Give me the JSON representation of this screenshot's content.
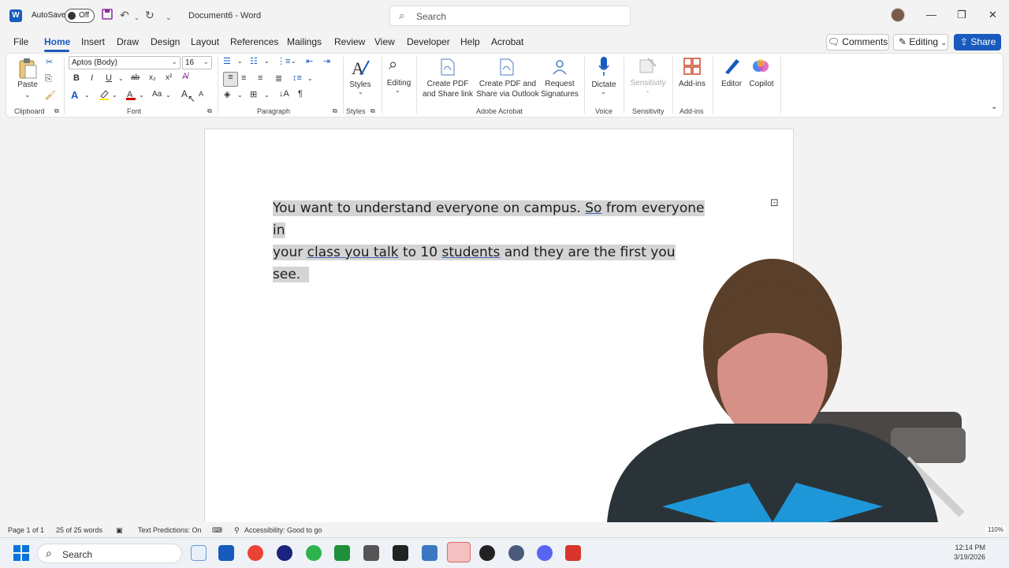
{
  "titlebar": {
    "app_logo": "W",
    "autosave_label": "AutoSave",
    "autosave_state": "Off",
    "doc_title": "Document6  -  Word",
    "search_placeholder": "Search",
    "icons": [
      "save-icon",
      "undo-icon",
      "redo-icon",
      "customize-qat-icon",
      "search-icon",
      "minimize-icon",
      "restore-icon",
      "close-icon"
    ]
  },
  "menu": {
    "tabs": [
      "File",
      "Home",
      "Insert",
      "Draw",
      "Design",
      "Layout",
      "References",
      "Mailings",
      "Review",
      "View",
      "Developer",
      "Help",
      "Acrobat"
    ],
    "active_tab": "Home",
    "comments_label": "Comments",
    "editing_label": "Editing",
    "share_label": "Share"
  },
  "ribbon": {
    "clipboard": {
      "paste_label": "Paste",
      "group_label": "Clipboard"
    },
    "font": {
      "font_name": "Aptos (Body)",
      "font_size": "16",
      "group_label": "Font",
      "bold": "B",
      "italic": "I",
      "underline": "U",
      "strike": "ab",
      "subscript": "x₂",
      "superscript": "x²",
      "change_case": "Aa",
      "grow": "A",
      "shrink": "A"
    },
    "paragraph": {
      "group_label": "Paragraph",
      "show_marks": "¶"
    },
    "styles": {
      "label": "Styles",
      "group_label": "Styles"
    },
    "editing": {
      "label": "Editing"
    },
    "acrobat": {
      "create_pdf_share_link": "Create PDF and Share link",
      "create_pdf_outlook": "Create PDF and Share via Outlook",
      "request_signatures": "Request Signatures",
      "group_label": "Adobe Acrobat"
    },
    "voice": {
      "dictate_label": "Dictate",
      "group_label": "Voice"
    },
    "sensitivity": {
      "label": "Sensitivity",
      "group_label": "Sensitivity"
    },
    "addins": {
      "label": "Add-ins",
      "group_label": "Add-ins"
    },
    "editor_label": "Editor",
    "copilot_label": "Copilot"
  },
  "document": {
    "line1_a": "You want to understand everyone on campus.  ",
    "line1_so": "So",
    "line1_b": " from everyone in",
    "line2_a": "your ",
    "line2_link1": "class you talk",
    "line2_b": " to 10 ",
    "line2_link2": "students",
    "line2_c": " and they are the first you see."
  },
  "status": {
    "page": "Page 1 of 1",
    "words": "25 of 25 words",
    "predictions": "Text Predictions: On",
    "accessibility": "Accessibility: Good to go",
    "zoom": "110%"
  },
  "taskbar": {
    "search_placeholder": "Search",
    "time": "12:14 PM",
    "date": "3/19/2026"
  }
}
